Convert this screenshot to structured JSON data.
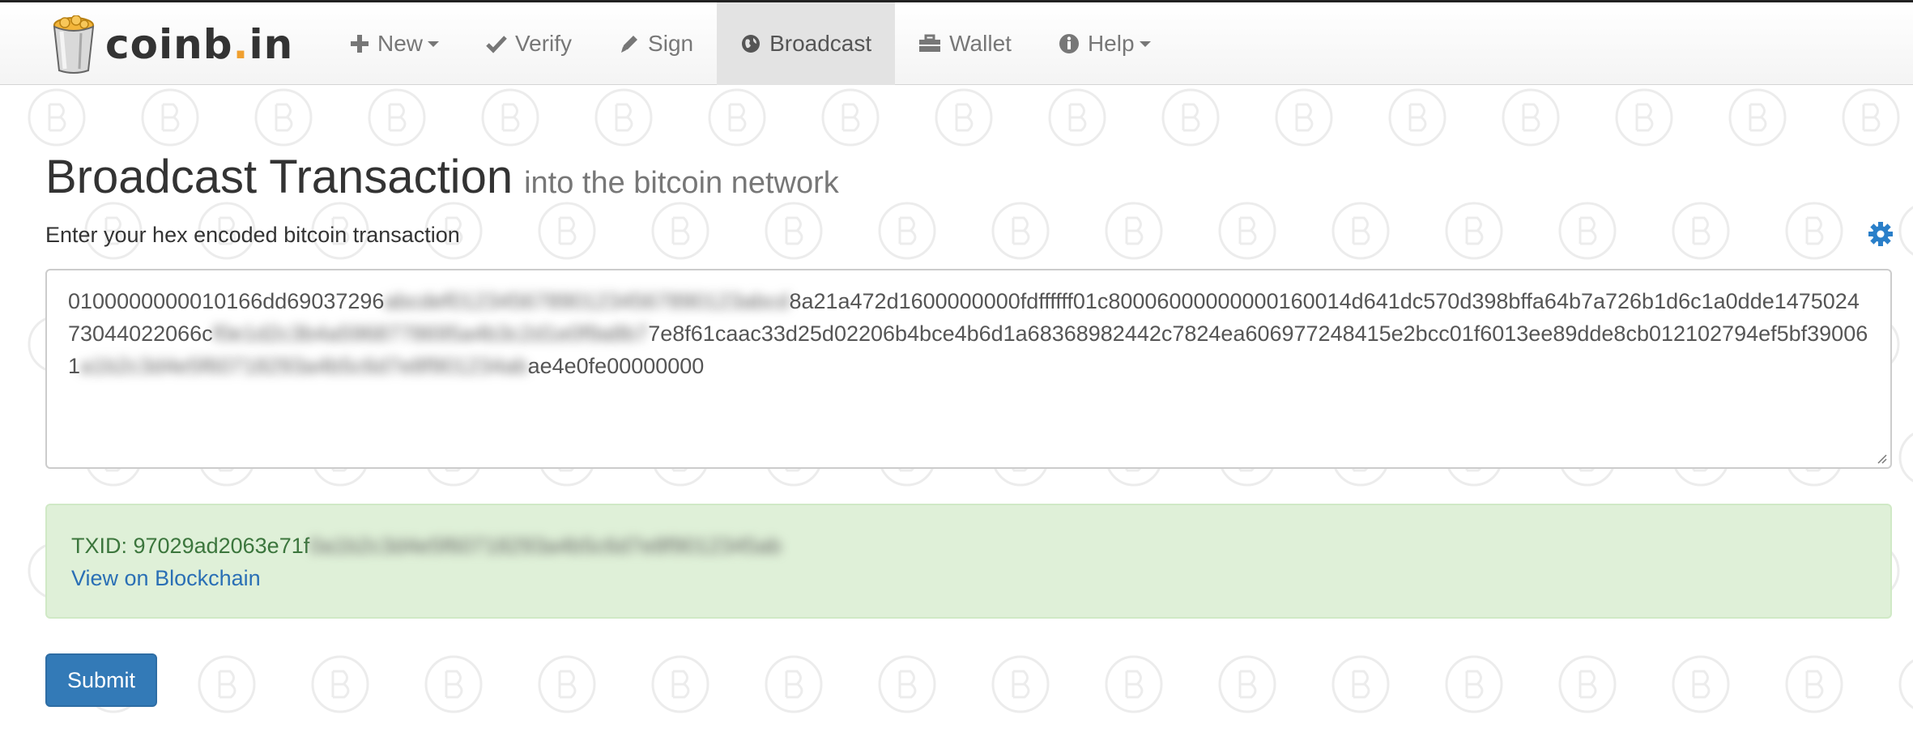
{
  "brand": {
    "name_main": "coinb",
    "name_dot": ".",
    "name_tail": "in"
  },
  "nav": {
    "items": [
      {
        "label": "New",
        "icon": "plus-icon",
        "dropdown": true
      },
      {
        "label": "Verify",
        "icon": "check-icon",
        "dropdown": false
      },
      {
        "label": "Sign",
        "icon": "pencil-icon",
        "dropdown": false
      },
      {
        "label": "Broadcast",
        "icon": "globe-icon",
        "dropdown": false,
        "active": true
      },
      {
        "label": "Wallet",
        "icon": "briefcase-icon",
        "dropdown": false
      },
      {
        "label": "Help",
        "icon": "info-icon",
        "dropdown": true
      }
    ]
  },
  "page": {
    "title": "Broadcast Transaction",
    "subtitle": "into the bitcoin network",
    "input_label": "Enter your hex encoded bitcoin transaction"
  },
  "transaction": {
    "line1_a": "0100000000010166dd69037296",
    "line1_blur": "abcdef012345678901234567890123abcd",
    "line1_b": "8a21a472d1600000000fdffffff01c80006000000000160014d641dc570d398bffa64b7a726b1d6",
    "line2_a": "c1a0dde147502473044022066c",
    "line2_blur": "f0e1d2c3b4a5968778695a4b3c2d1e0f9a8b7",
    "line2_b": "7e8f61caac33d25d02206b4bce4b6d1a68368982442c7824ea606977248415e2bcc01f6013ee8",
    "line3_a": "9dde8cb012102794ef5bf390061",
    "line3_blur": "a1b2c3d4e5f60718293a4b5c6d7e8f901234ab",
    "line3_b": "ae4e0fe00000000"
  },
  "result": {
    "txid_label": "TXID: 97029ad2063e71f",
    "txid_blur": "0a1b2c3d4e5f60718293a4b5c6d7e8f9012345ab",
    "link_label": "View on Blockchain"
  },
  "submit_label": "Submit",
  "colors": {
    "accent": "#337ab7",
    "success_bg": "#dff0d8",
    "success_text": "#3c763d",
    "settings_icon": "#2a7fc9",
    "brand_dot": "#f0a030"
  }
}
